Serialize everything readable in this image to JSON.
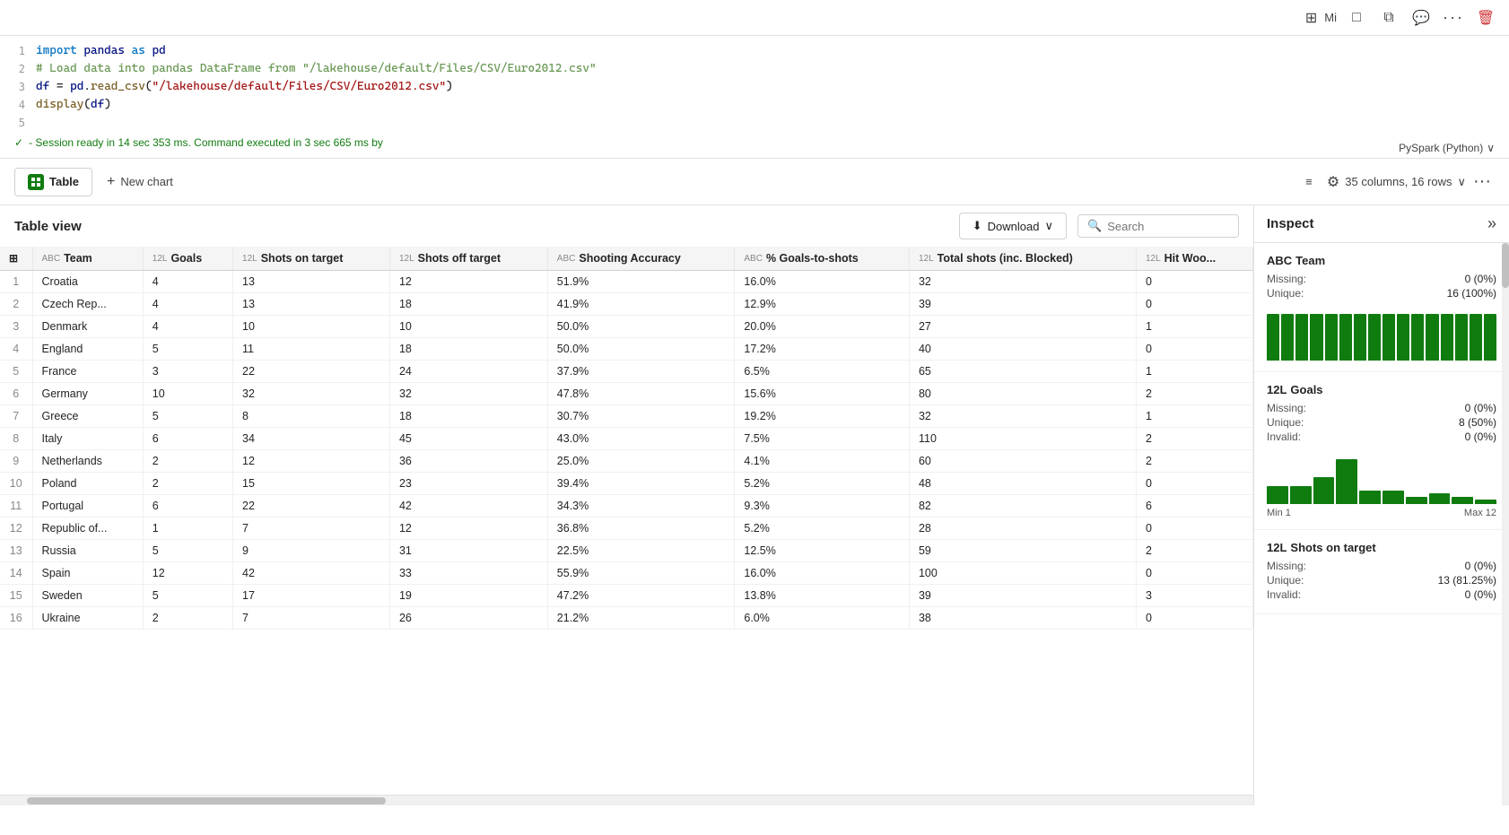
{
  "toolbar": {
    "mi_label": "Mi",
    "pyspark_label": "PySpark (Python)"
  },
  "code": {
    "lines": [
      {
        "num": 1,
        "content": "import pandas as pd"
      },
      {
        "num": 2,
        "content": "# Load data into pandas DataFrame from \"/lakehouse/default/Files/CSV/Euro2012.csv\""
      },
      {
        "num": 3,
        "content": "df = pd.read_csv(\"/lakehouse/default/Files/CSV/Euro2012.csv\")"
      },
      {
        "num": 4,
        "content": "display(df)"
      },
      {
        "num": 5,
        "content": ""
      }
    ],
    "status": "- Session ready in 14 sec 353 ms. Command executed in 3 sec 665 ms by"
  },
  "table_toolbar": {
    "table_label": "Table",
    "new_chart_label": "New chart",
    "col_info": "35 columns, 16 rows"
  },
  "table_view": {
    "title": "Table view",
    "download_label": "Download",
    "search_placeholder": "Search"
  },
  "columns": [
    {
      "id": "row",
      "type": "",
      "label": ""
    },
    {
      "id": "team",
      "type": "ABC",
      "label": "Team"
    },
    {
      "id": "goals",
      "type": "12L",
      "label": "Goals"
    },
    {
      "id": "shots_on_target",
      "type": "12L",
      "label": "Shots on target"
    },
    {
      "id": "shots_off_target",
      "type": "12L",
      "label": "Shots off target"
    },
    {
      "id": "shooting_accuracy",
      "type": "ABC",
      "label": "Shooting Accuracy"
    },
    {
      "id": "pct_goals_to_shots",
      "type": "ABC",
      "label": "% Goals-to-shots"
    },
    {
      "id": "total_shots_inc_blocked",
      "type": "12L",
      "label": "Total shots (inc. Blocked)"
    },
    {
      "id": "hit_woodwork",
      "type": "12L",
      "label": "Hit Woo..."
    }
  ],
  "rows": [
    {
      "num": 1,
      "team": "Croatia",
      "goals": 4,
      "shots_on": 13,
      "shots_off": 12,
      "shoot_acc": "51.9%",
      "pct_goals": "16.0%",
      "total_shots": 32,
      "hit_wood": 0
    },
    {
      "num": 2,
      "team": "Czech Rep...",
      "goals": 4,
      "shots_on": 13,
      "shots_off": 18,
      "shoot_acc": "41.9%",
      "pct_goals": "12.9%",
      "total_shots": 39,
      "hit_wood": 0
    },
    {
      "num": 3,
      "team": "Denmark",
      "goals": 4,
      "shots_on": 10,
      "shots_off": 10,
      "shoot_acc": "50.0%",
      "pct_goals": "20.0%",
      "total_shots": 27,
      "hit_wood": 1
    },
    {
      "num": 4,
      "team": "England",
      "goals": 5,
      "shots_on": 11,
      "shots_off": 18,
      "shoot_acc": "50.0%",
      "pct_goals": "17.2%",
      "total_shots": 40,
      "hit_wood": 0
    },
    {
      "num": 5,
      "team": "France",
      "goals": 3,
      "shots_on": 22,
      "shots_off": 24,
      "shoot_acc": "37.9%",
      "pct_goals": "6.5%",
      "total_shots": 65,
      "hit_wood": 1
    },
    {
      "num": 6,
      "team": "Germany",
      "goals": 10,
      "shots_on": 32,
      "shots_off": 32,
      "shoot_acc": "47.8%",
      "pct_goals": "15.6%",
      "total_shots": 80,
      "hit_wood": 2
    },
    {
      "num": 7,
      "team": "Greece",
      "goals": 5,
      "shots_on": 8,
      "shots_off": 18,
      "shoot_acc": "30.7%",
      "pct_goals": "19.2%",
      "total_shots": 32,
      "hit_wood": 1
    },
    {
      "num": 8,
      "team": "Italy",
      "goals": 6,
      "shots_on": 34,
      "shots_off": 45,
      "shoot_acc": "43.0%",
      "pct_goals": "7.5%",
      "total_shots": 110,
      "hit_wood": 2
    },
    {
      "num": 9,
      "team": "Netherlands",
      "goals": 2,
      "shots_on": 12,
      "shots_off": 36,
      "shoot_acc": "25.0%",
      "pct_goals": "4.1%",
      "total_shots": 60,
      "hit_wood": 2
    },
    {
      "num": 10,
      "team": "Poland",
      "goals": 2,
      "shots_on": 15,
      "shots_off": 23,
      "shoot_acc": "39.4%",
      "pct_goals": "5.2%",
      "total_shots": 48,
      "hit_wood": 0
    },
    {
      "num": 11,
      "team": "Portugal",
      "goals": 6,
      "shots_on": 22,
      "shots_off": 42,
      "shoot_acc": "34.3%",
      "pct_goals": "9.3%",
      "total_shots": 82,
      "hit_wood": 6
    },
    {
      "num": 12,
      "team": "Republic of...",
      "goals": 1,
      "shots_on": 7,
      "shots_off": 12,
      "shoot_acc": "36.8%",
      "pct_goals": "5.2%",
      "total_shots": 28,
      "hit_wood": 0
    },
    {
      "num": 13,
      "team": "Russia",
      "goals": 5,
      "shots_on": 9,
      "shots_off": 31,
      "shoot_acc": "22.5%",
      "pct_goals": "12.5%",
      "total_shots": 59,
      "hit_wood": 2
    },
    {
      "num": 14,
      "team": "Spain",
      "goals": 12,
      "shots_on": 42,
      "shots_off": 33,
      "shoot_acc": "55.9%",
      "pct_goals": "16.0%",
      "total_shots": 100,
      "hit_wood": 0
    },
    {
      "num": 15,
      "team": "Sweden",
      "goals": 5,
      "shots_on": 17,
      "shots_off": 19,
      "shoot_acc": "47.2%",
      "pct_goals": "13.8%",
      "total_shots": 39,
      "hit_wood": 3
    },
    {
      "num": 16,
      "team": "Ukraine",
      "goals": 2,
      "shots_on": 7,
      "shots_off": 26,
      "shoot_acc": "21.2%",
      "pct_goals": "6.0%",
      "total_shots": 38,
      "hit_wood": 0
    }
  ],
  "inspect": {
    "title": "Inspect",
    "team_col": {
      "name": "Team",
      "type": "ABC",
      "missing": "0 (0%)",
      "unique": "16 (100%)",
      "bars": [
        60,
        60,
        60,
        60,
        60,
        60,
        60,
        60,
        60,
        60,
        60,
        60,
        60,
        60,
        60,
        60
      ]
    },
    "goals_col": {
      "name": "Goals",
      "type": "12L",
      "missing": "0 (0%)",
      "unique": "8 (50%)",
      "invalid": "0 (0%)",
      "min": "Min 1",
      "max": "Max 12",
      "bars": [
        30,
        30,
        30,
        55,
        20,
        20,
        10,
        15,
        10,
        8
      ]
    },
    "shots_on_target_col": {
      "name": "Shots on target",
      "type": "12L",
      "missing": "0 (0%)",
      "unique": "13 (81.25%)",
      "invalid": "0 (0%)"
    }
  }
}
